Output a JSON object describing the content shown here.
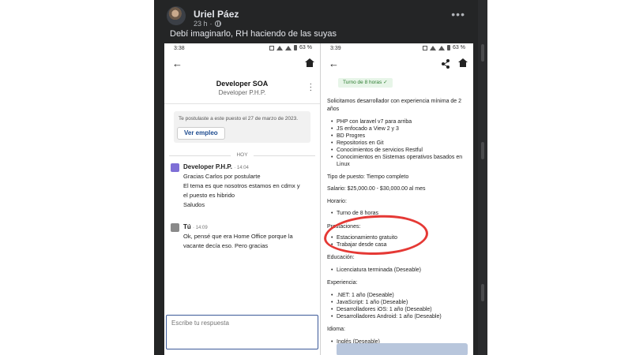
{
  "post": {
    "author": "Uriel Páez",
    "time": "23 h",
    "caption": "Debí imaginarlo, RH haciendo de las suyas",
    "more_icon": "more-icon"
  },
  "phone_left": {
    "status_time": "3:38",
    "battery": "63 %",
    "chat_title": "Developer SOA",
    "chat_subtitle": "Developer P.H.P.",
    "notice": "Te postulaste a este puesto el 27 de marzo de 2023.",
    "view_job_label": "Ver empleo",
    "day_divider": "HOY",
    "messages": [
      {
        "sender": "Developer P.H.P.",
        "time": "14:04",
        "lines": [
          "Gracias Carlos por postularte",
          "El tema es que nosotros estamos en cdmx y",
          "el puesto es hibrido",
          "Saludos"
        ]
      },
      {
        "sender": "Tú",
        "time": "14:09",
        "lines": [
          "Ok, pensé que era Home Office porque la",
          "vacante decía eso. Pero gracias"
        ]
      }
    ],
    "reply_placeholder": "Escribe tu respuesta"
  },
  "phone_right": {
    "status_time": "3:39",
    "battery": "63 %",
    "shift_chip": "Turno de 8 horas ✓",
    "intro": [
      "Solicitamos desarrollador con experiencia mínima de 2",
      "años"
    ],
    "requirements": [
      "PHP con laravel v7 para arriba",
      "JS enfocado a View 2 y 3",
      "BD Progres",
      "Repositorios en Git",
      "Conocimientos de servicios Restful",
      "Conocimientos en Sistemas operativos basados en",
      "Linux"
    ],
    "job_type": "Tipo de puesto: Tiempo completo",
    "salary": "Salario: $25,000.00 - $30,000.00 al mes",
    "schedule_heading": "Horario:",
    "schedule_item": "Turno de 8 horas",
    "benefits_heading": "Prestaciones:",
    "benefits": [
      "Estacionamiento gratuito",
      "Trabajar desde casa"
    ],
    "education_heading": "Educación:",
    "education_item": "Licenciatura terminada (Deseable)",
    "experience_heading": "Experiencia:",
    "experience": [
      ".NET: 1 año (Deseable)",
      "JavaScript: 1 año (Deseable)",
      "Desarrolladores iOS: 1 año (Deseable)",
      "Desarrolladores Android: 1 año (Deseable)"
    ],
    "language_heading": "Idioma:",
    "language_item": "Inglés (Deseable)"
  },
  "colors": {
    "post_bg": "#242526",
    "highlight": "#e53935",
    "link_blue": "#1d4b8f",
    "chip_green": "#2e7d32"
  }
}
